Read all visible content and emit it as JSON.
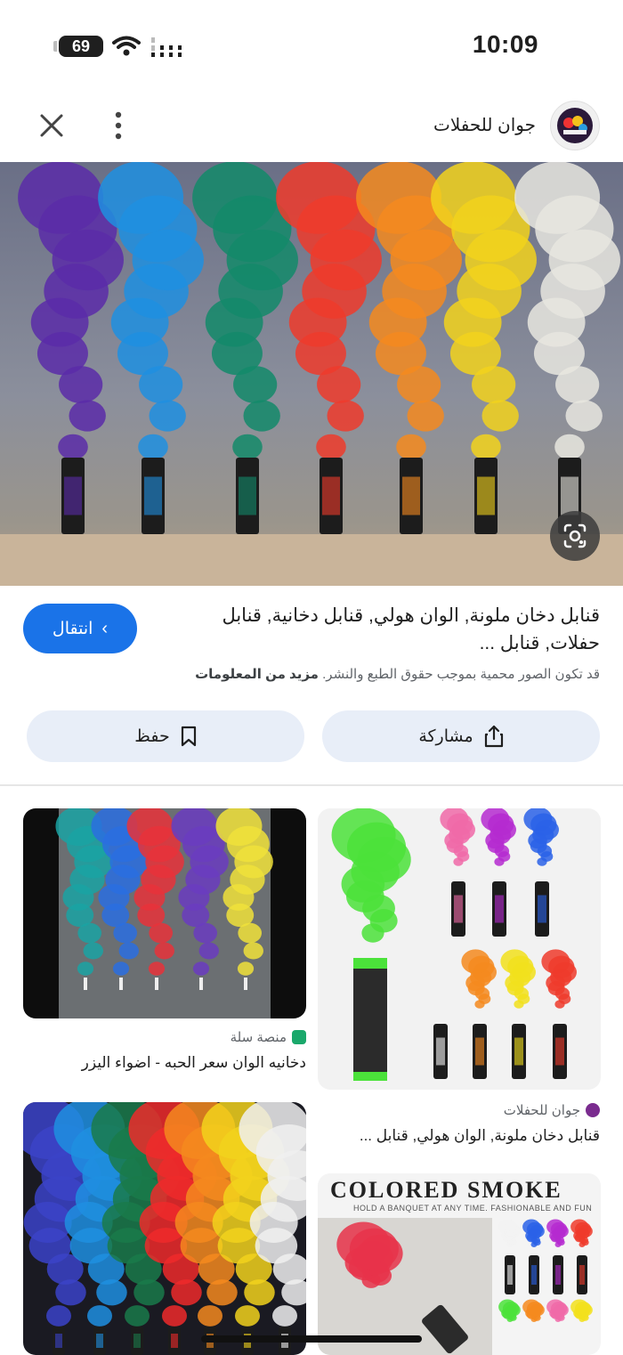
{
  "status_bar": {
    "time": "10:09",
    "battery": "69"
  },
  "header": {
    "source_name": "جوان للحفلات"
  },
  "result": {
    "title": "قنابل دخان ملونة, الوان هولي, قنابل دخانية, قنابل حفلات, قنابل ...",
    "visit_label": "انتقال",
    "copyright_text": "قد تكون الصور محمية بموجب حقوق الطبع والنشر.",
    "learn_more": "مزيد من المعلومات",
    "share_label": "مشاركة",
    "save_label": "حفظ"
  },
  "hero_smoke_colors": [
    "#5a2ca8",
    "#1f8fe0",
    "#138a6a",
    "#ef3b2c",
    "#f58a1f",
    "#f2d21c",
    "#e8e6df"
  ],
  "grid": [
    {
      "source": "منصة سلة",
      "title": "دخانيه الوان سعر الحبه - اضواء اليزر",
      "colors": [
        "#1aa3a3",
        "#2a6ee0",
        "#e8323a",
        "#6a3cc0",
        "#f0e23a"
      ]
    },
    {
      "source": "",
      "title": "",
      "colors": [
        "#4be23a",
        "#f06aa8",
        "#b52ad0",
        "#2a62e8",
        "#f2f2f2",
        "#f58a1f",
        "#f2e01c",
        "#ef3b2c"
      ]
    },
    {
      "source": "",
      "title": "",
      "colors": [
        "#3b43c8",
        "#1f8fe0",
        "#1a7a4a",
        "#ef2a2a",
        "#f58a1f",
        "#f2d21c",
        "#f0f0f0"
      ]
    },
    {
      "source": "جوان للحفلات",
      "title": "قنابل دخان ملونة, الوان هولي, قنابل ...",
      "banner": "COLORED SMOKE",
      "banner_sub": "HOLD A BANQUET AT ANY TIME. FASHIONABLE AND FUN"
    }
  ]
}
